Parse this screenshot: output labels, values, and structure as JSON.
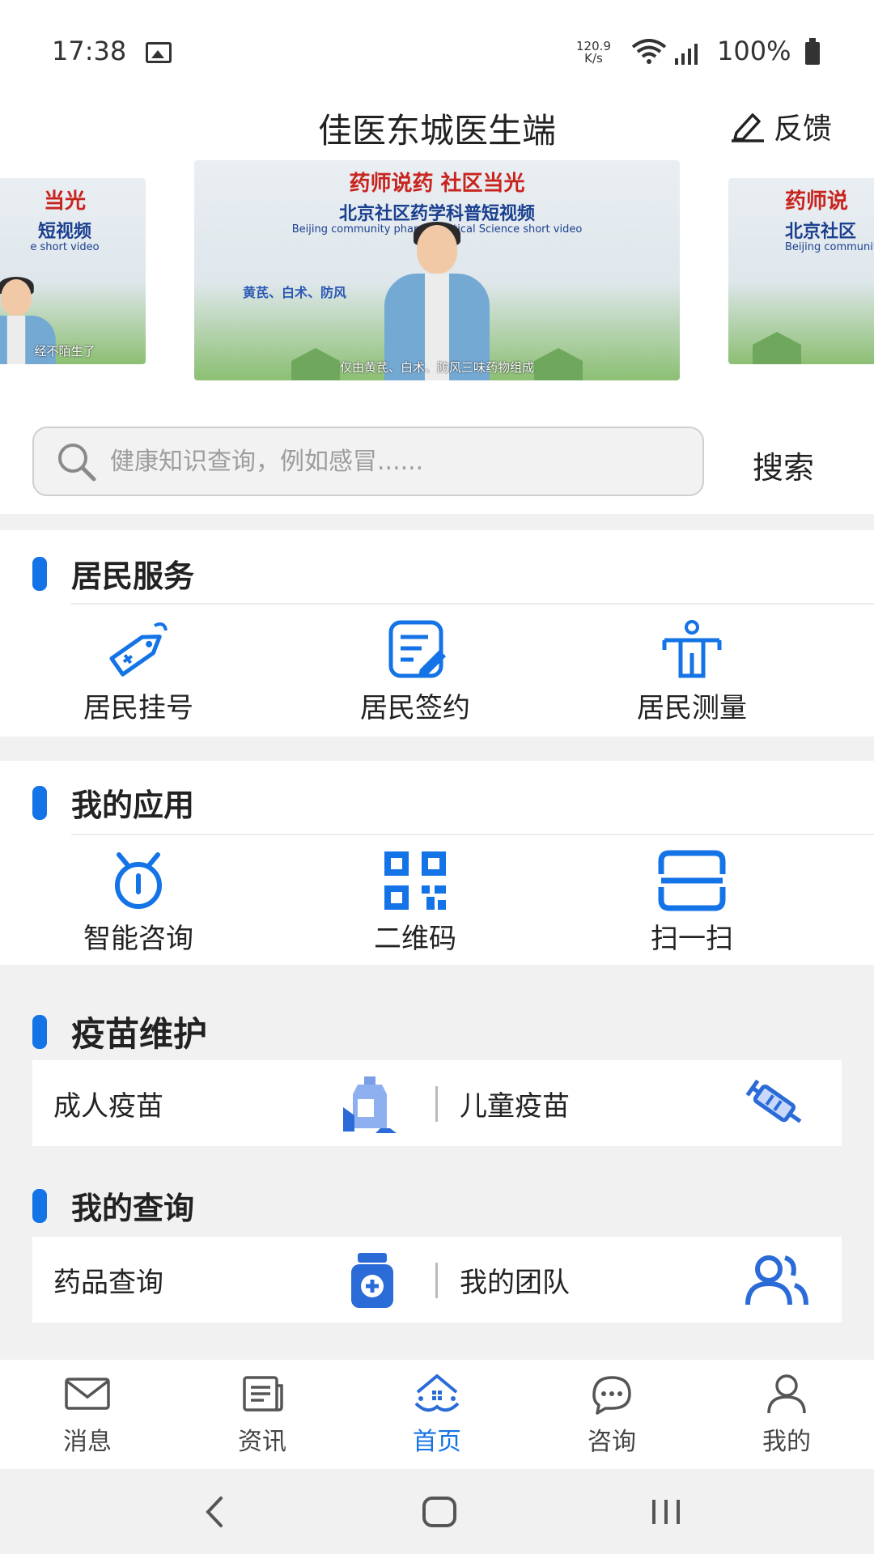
{
  "status": {
    "time": "17:38",
    "speed_value": "120.9",
    "speed_unit": "K/s",
    "battery": "100%"
  },
  "header": {
    "title": "佳医东城医生端",
    "feedback_label": "反馈"
  },
  "carousel": {
    "main": {
      "banner_line1": "药师说药  社区当光",
      "banner_line2": "北京社区药学科普短视频",
      "banner_line3": "Beijing community pharmaceutical Science short video",
      "side_text": "黄芪、白术、防风",
      "caption": "仅由黄芪、白术、防风三味药物组成"
    },
    "left": {
      "banner_line1": "当光",
      "banner_line2": "短视频",
      "banner_line3": "e short video",
      "caption": "经不陌生了"
    },
    "right": {
      "banner_line1": "药师说",
      "banner_line2": "北京社区",
      "banner_line3": "Beijing communit"
    }
  },
  "search": {
    "placeholder": "健康知识查询，例如感冒......",
    "button_label": "搜索"
  },
  "resident_services": {
    "title": "居民服务",
    "items": [
      {
        "label": "居民挂号",
        "icon": "tag-icon"
      },
      {
        "label": "居民签约",
        "icon": "contract-edit-icon"
      },
      {
        "label": "居民测量",
        "icon": "body-measure-icon"
      }
    ]
  },
  "my_apps": {
    "title": "我的应用",
    "items": [
      {
        "label": "智能咨询",
        "icon": "alarm-clock-icon"
      },
      {
        "label": "二维码",
        "icon": "qr-code-icon"
      },
      {
        "label": "扫一扫",
        "icon": "scan-icon"
      }
    ]
  },
  "vaccine": {
    "title": "疫苗维护",
    "left_label": "成人疫苗",
    "right_label": "儿童疫苗"
  },
  "query": {
    "title": "我的查询",
    "left_label": "药品查询",
    "right_label": "我的团队"
  },
  "tabbar": {
    "items": [
      {
        "label": "消息",
        "icon": "mail-icon"
      },
      {
        "label": "资讯",
        "icon": "news-icon"
      },
      {
        "label": "首页",
        "icon": "home-icon",
        "active": true
      },
      {
        "label": "咨询",
        "icon": "chat-icon"
      },
      {
        "label": "我的",
        "icon": "user-icon"
      }
    ]
  },
  "colors": {
    "accent": "#1473e6",
    "background": "#f1f1f1"
  }
}
